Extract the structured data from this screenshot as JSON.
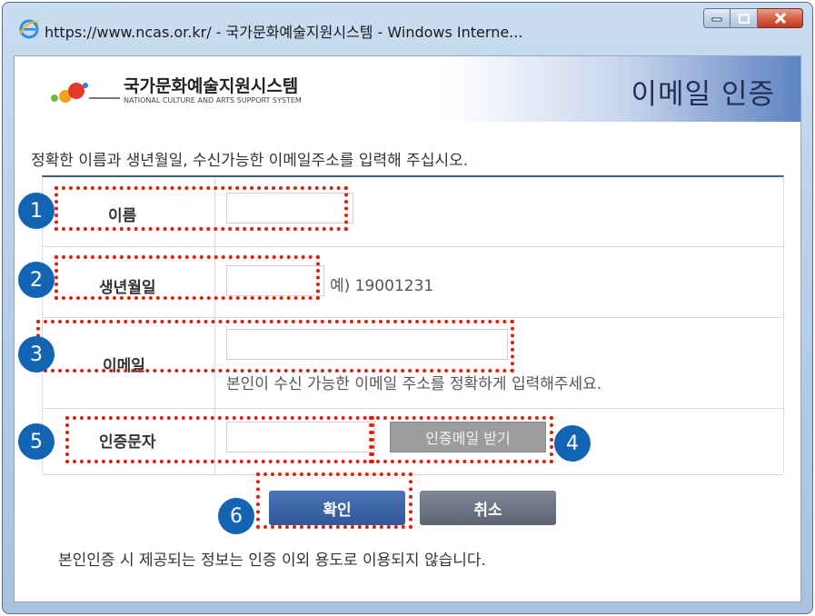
{
  "window": {
    "title": "https://www.ncas.or.kr/ - 국가문화예술지원시스템 - Windows Interne...",
    "icon": "ie-icon"
  },
  "header": {
    "logo_ko": "국가문화예술지원시스템",
    "logo_en": "NATIONAL CULTURE AND ARTS SUPPORT SYSTEM",
    "title": "이메일 인증"
  },
  "instruction": "정확한 이름과 생년월일, 수신가능한 이메일주소를 입력해 주십시오.",
  "form": {
    "name_label": "이름",
    "name_value": "",
    "birth_label": "생년월일",
    "birth_value": "",
    "birth_hint": "예) 19001231",
    "email_label": "이메일",
    "email_value": "",
    "email_hint": "본인이 수신 가능한 이메일 주소를 정확하게 입력해주세요.",
    "code_label": "인증문자",
    "code_value": "",
    "get_mail_button": "인증메일 받기"
  },
  "buttons": {
    "ok": "확인",
    "cancel": "취소"
  },
  "footer_note": "본인인증 시 제공되는 정보는 인증 이외 용도로 이용되지 않습니다.",
  "annotations": [
    "1",
    "2",
    "3",
    "4",
    "5",
    "6"
  ],
  "colors": {
    "annotation_border": "#d9200f",
    "badge": "#1464b4",
    "ok_button": "#2f5799",
    "cancel_button": "#5c6571",
    "mail_button": "#9c9c9c"
  }
}
